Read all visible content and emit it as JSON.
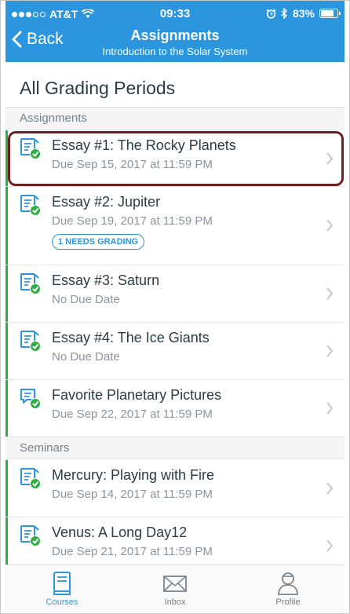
{
  "status_bar": {
    "carrier": "AT&T",
    "time": "09:33",
    "battery": "83%",
    "battery_level": 0.83
  },
  "nav": {
    "back_label": "Back",
    "title": "Assignments",
    "subtitle": "Introduction to the Solar System"
  },
  "page_title": "All Grading Periods",
  "sections": [
    {
      "header": "Assignments",
      "items": [
        {
          "title": "Essay #1: The Rocky Planets",
          "due": "Due Sep 15, 2017 at 11:59 PM",
          "icon": "assignment-published-icon"
        },
        {
          "title": "Essay #2: Jupiter",
          "due": "Due Sep 19, 2017 at 11:59 PM",
          "badge": "1 NEEDS GRADING",
          "icon": "assignment-published-icon"
        },
        {
          "title": "Essay #3: Saturn",
          "due": "No Due Date",
          "icon": "assignment-published-icon"
        },
        {
          "title": "Essay #4: The Ice Giants",
          "due": "No Due Date",
          "icon": "assignment-published-icon"
        },
        {
          "title": "Favorite Planetary Pictures",
          "due": "Due Sep 22, 2017 at 11:59 PM",
          "icon": "discussion-published-icon"
        }
      ]
    },
    {
      "header": "Seminars",
      "items": [
        {
          "title": "Mercury: Playing with Fire",
          "due": "Due Sep 14, 2017 at 11:59 PM",
          "icon": "assignment-published-icon"
        },
        {
          "title": "Venus: A Long Day12",
          "due": "Due Sep 21, 2017 at 11:59 PM",
          "icon": "assignment-published-icon"
        }
      ]
    }
  ],
  "tabs": [
    {
      "label": "Courses",
      "icon": "courses-icon",
      "active": true
    },
    {
      "label": "Inbox",
      "icon": "inbox-icon",
      "active": false
    },
    {
      "label": "Profile",
      "icon": "profile-icon",
      "active": false
    }
  ],
  "colors": {
    "brand": "#2b96de",
    "published": "#2fac46",
    "highlight": "#6e1e22"
  }
}
